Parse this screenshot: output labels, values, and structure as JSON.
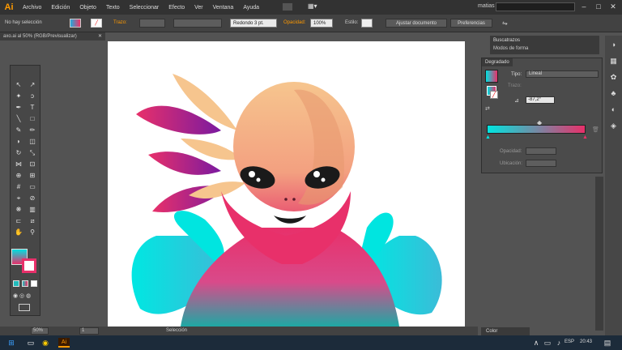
{
  "app": {
    "logo": "Ai",
    "workspace_user": "matias"
  },
  "menubar": [
    "Archivo",
    "Edición",
    "Objeto",
    "Texto",
    "Seleccionar",
    "Efecto",
    "Ver",
    "Ventana",
    "Ayuda"
  ],
  "control": {
    "selection": "No hay selección",
    "stroke_label": "Trazo:",
    "brush": "Redondo 3 pt.",
    "opacity_label": "Opacidad:",
    "opacity_value": "100%",
    "style_label": "Estilo:",
    "doc_setup": "Ajustar documento",
    "prefs": "Preferencias"
  },
  "document": {
    "tab_title": "axo.ai al 50% (RGB/Previsualizar)"
  },
  "panels": {
    "top_tabs": [
      "Buscatrazos",
      "Modos de forma"
    ],
    "gradient": {
      "title": "Degradado",
      "type_label": "Tipo:",
      "type_value": "Lineal",
      "stroke_label": "Trazo:",
      "angle_value": "-87,2°",
      "opacity_label": "Opacidad:",
      "location_label": "Ubicación:"
    },
    "color_tab": "Color"
  },
  "status": {
    "zoom": "50%",
    "artboard_num": "1",
    "tool": "Selección"
  },
  "taskbar": {
    "lang": "ESP",
    "time": "20:43"
  },
  "colors": {
    "accent": "#ff9a00",
    "cyan": "#00e5e0",
    "magenta": "#e8306a",
    "purple": "#8a1ea0",
    "skin": "#f6c58e"
  }
}
